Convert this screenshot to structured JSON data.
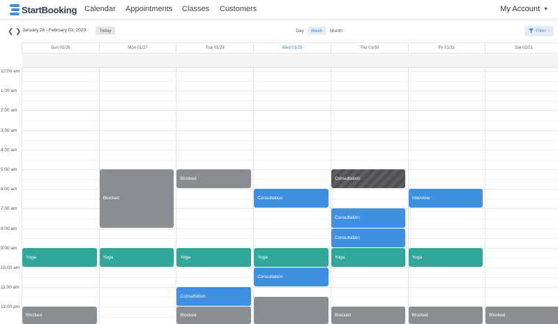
{
  "brand": {
    "name": "StartBooking",
    "accent": "#3a8dde"
  },
  "nav": {
    "items": [
      "Calendar",
      "Appointments",
      "Classes",
      "Customers"
    ],
    "account": "My Account"
  },
  "toolbar": {
    "date_range": "January 26 - February 01, 2020",
    "today": "Today",
    "views": [
      "Day",
      "Week",
      "Month"
    ],
    "active_view": "Week",
    "filter": "Filter"
  },
  "days": [
    "Sun 01/26",
    "Mon 01/27",
    "Tue 01/28",
    "Wed 01/29",
    "Thu 01/30",
    "Fri 01/31",
    "Sat 02/01"
  ],
  "current_day": "Wed 01/29",
  "hours": [
    "12:00 am",
    "1:00 am",
    "2:00 am",
    "3:00 am",
    "4:00 am",
    "5:00 am",
    "6:00 am",
    "7:00 am",
    "8:00 am",
    "9:00 am",
    "10:00 am",
    "11:00 am",
    "12:00 pm"
  ],
  "events": [
    {
      "title": "Blocked",
      "day": 1,
      "start": 5,
      "end": 8,
      "kind": "gray"
    },
    {
      "title": "Blocked",
      "day": 2,
      "start": 5,
      "end": 6,
      "kind": "gray"
    },
    {
      "title": "Consultation",
      "day": 4,
      "start": 5,
      "end": 6,
      "kind": "dark"
    },
    {
      "title": "Consultation",
      "day": 3,
      "start": 6,
      "end": 7,
      "kind": "blue"
    },
    {
      "title": "Interview",
      "day": 5,
      "start": 6,
      "end": 7,
      "kind": "blue"
    },
    {
      "title": "Consultation",
      "day": 4,
      "start": 7,
      "end": 8,
      "kind": "blue"
    },
    {
      "title": "Consultation",
      "day": 4,
      "start": 8,
      "end": 9,
      "kind": "blue"
    },
    {
      "title": "Yoga",
      "day": 0,
      "start": 9,
      "end": 10,
      "kind": "teal"
    },
    {
      "title": "Yoga",
      "day": 1,
      "start": 9,
      "end": 10,
      "kind": "teal"
    },
    {
      "title": "Yoga",
      "day": 2,
      "start": 9,
      "end": 10,
      "kind": "teal"
    },
    {
      "title": "Yoga",
      "day": 3,
      "start": 9,
      "end": 10,
      "kind": "teal"
    },
    {
      "title": "Yoga",
      "day": 4,
      "start": 9,
      "end": 10,
      "kind": "teal"
    },
    {
      "title": "Yoga",
      "day": 5,
      "start": 9,
      "end": 10,
      "kind": "teal"
    },
    {
      "title": "Consultation",
      "day": 3,
      "start": 10,
      "end": 11,
      "kind": "blue"
    },
    {
      "title": "Consultation",
      "day": 2,
      "start": 11,
      "end": 12,
      "kind": "blue"
    },
    {
      "title": "",
      "day": 3,
      "start": 11.5,
      "end": 13,
      "kind": "gray"
    },
    {
      "title": "Blocked",
      "day": 0,
      "start": 12,
      "end": 13,
      "kind": "gray"
    },
    {
      "title": "Blocked",
      "day": 2,
      "start": 12,
      "end": 13,
      "kind": "gray"
    },
    {
      "title": "Blocked",
      "day": 4,
      "start": 12,
      "end": 13,
      "kind": "gray"
    },
    {
      "title": "Blocked",
      "day": 5,
      "start": 12,
      "end": 13,
      "kind": "gray"
    },
    {
      "title": "Blocked",
      "day": 6,
      "start": 12,
      "end": 13,
      "kind": "gray"
    }
  ]
}
